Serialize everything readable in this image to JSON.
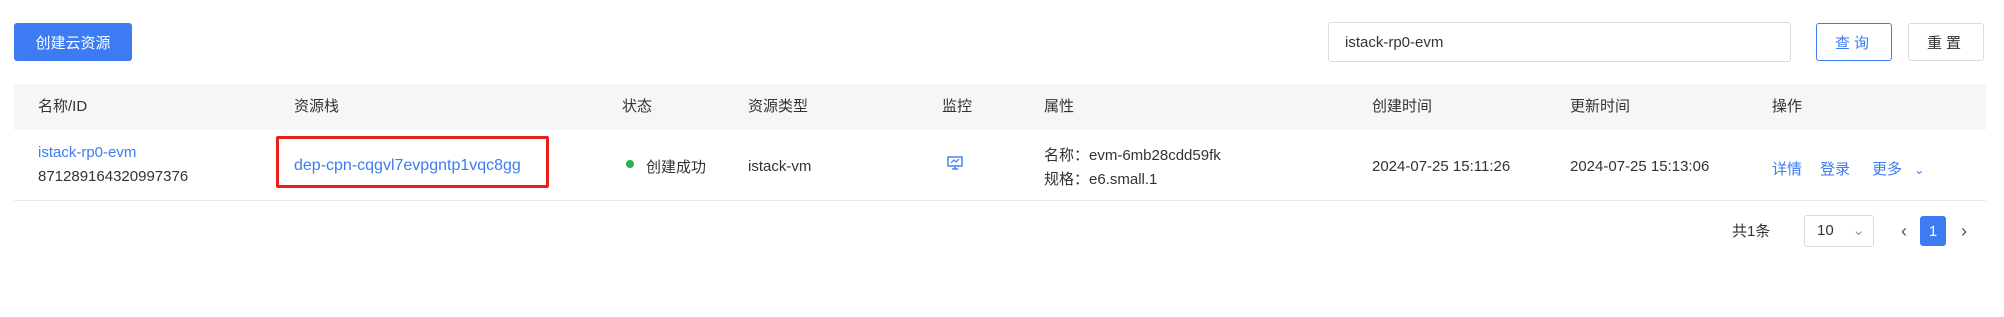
{
  "toolbar": {
    "create_label": "创建云资源",
    "search_value": "istack-rp0-evm",
    "query_label": "查询",
    "reset_label": "重置"
  },
  "table": {
    "columns": [
      "名称/ID",
      "资源栈",
      "状态",
      "资源类型",
      "监控",
      "属性",
      "创建时间",
      "更新时间",
      "操作"
    ],
    "rows": [
      {
        "name": "istack-rp0-evm",
        "id": "871289164320997376",
        "stack": "dep-cpn-cqgvl7evpgntp1vqc8gg",
        "status": "创建成功",
        "type": "istack-vm",
        "monitor_icon": "monitor-icon",
        "attr_name": "名称：evm-6mb28cdd59fk",
        "attr_spec": "规格：e6.small.1",
        "created": "2024-07-25 15:11:26",
        "updated": "2024-07-25 15:13:06",
        "actions": {
          "detail": "详情",
          "login": "登录",
          "more": "更多"
        }
      }
    ]
  },
  "pagination": {
    "total": "共1条",
    "page_size": "10",
    "current_page": "1"
  },
  "colors": {
    "accent": "#3d7bf2",
    "success": "#2bb24c",
    "highlight": "#e8201c"
  }
}
